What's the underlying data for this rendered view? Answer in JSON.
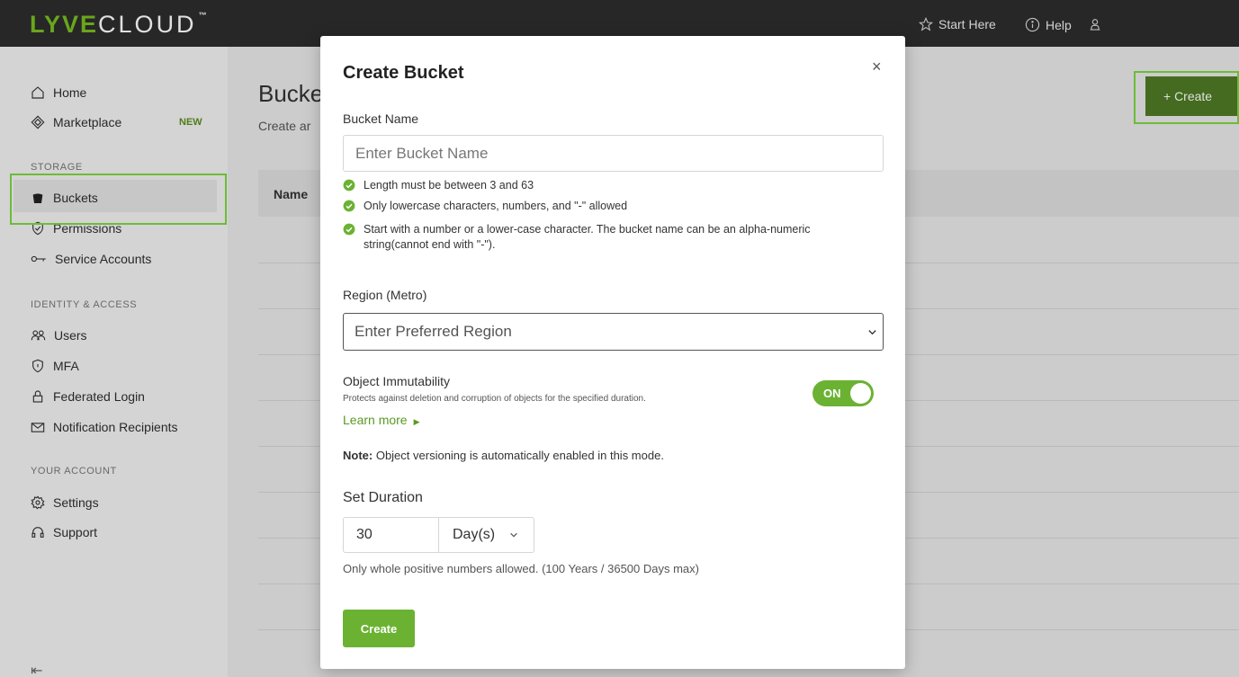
{
  "brand": {
    "logo_part1": "LYVE",
    "logo_part2": "CLOUD",
    "logo_tm": "™"
  },
  "topnav": {
    "start_here": "Start Here",
    "help": "Help"
  },
  "sidebar": {
    "home": "Home",
    "marketplace": "Marketplace",
    "marketplace_badge": "NEW",
    "storage_section": "STORAGE",
    "buckets": "Buckets",
    "permissions": "Permissions",
    "service_accounts": "Service Accounts",
    "identity_section": "IDENTITY & ACCESS",
    "users": "Users",
    "mfa": "MFA",
    "federated_login": "Federated Login",
    "notification_recipients": "Notification Recipients",
    "account_section": "YOUR ACCOUNT",
    "settings": "Settings",
    "support": "Support",
    "collapse": "⇤"
  },
  "page": {
    "title": "Bucke",
    "subtitle": "Create ar",
    "column_name": "Name",
    "create_button": "+ Create"
  },
  "modal": {
    "title": "Create Bucket",
    "close": "×",
    "bucket_name_label": "Bucket Name",
    "bucket_name_placeholder": "Enter Bucket Name",
    "rules": [
      "Length must be between 3 and 63",
      "Only lowercase characters, numbers, and \"-\" allowed",
      "Start with a number or a lower-case character. The bucket name can be an alpha-numeric string(cannot end with \"-\")."
    ],
    "region_label": "Region (Metro)",
    "region_placeholder": "Enter Preferred Region",
    "immutability_title": "Object Immutability",
    "immutability_desc": "Protects against deletion and corruption of objects for the specified duration.",
    "learn_more": "Learn more",
    "toggle_label": "ON",
    "note_prefix": "Note:",
    "note_text": " Object versioning is automatically enabled in this mode.",
    "duration_title": "Set Duration",
    "duration_value": "30",
    "duration_unit": "Day(s)",
    "duration_hint": "Only whole positive numbers allowed. (100 Years / 36500 Days max)",
    "create_label": "Create"
  },
  "colors": {
    "accent": "#6bb233",
    "highlight": "#7bd640",
    "topbar": "#2d2d2d"
  }
}
